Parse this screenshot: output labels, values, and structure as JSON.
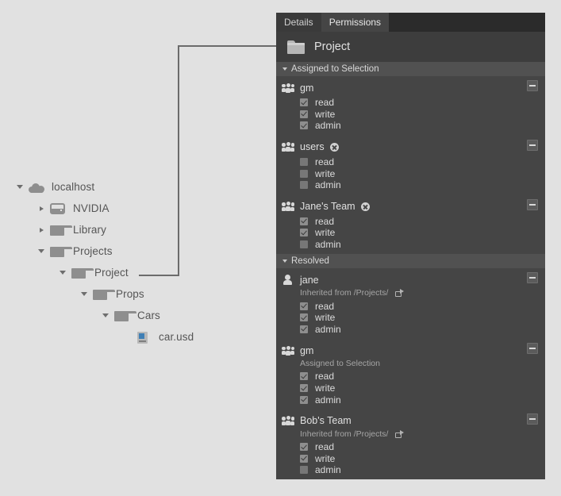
{
  "tabs": [
    {
      "label": "Details",
      "active": false
    },
    {
      "label": "Permissions",
      "active": true
    }
  ],
  "panel_header": {
    "title": "Project",
    "icon": "folder-icon"
  },
  "sections": [
    {
      "id": "assigned-to-selection",
      "title": "Assigned to Selection",
      "entries": [
        {
          "name": "gm",
          "icon": "group-icon",
          "removable": false,
          "subtitle": null,
          "link": false,
          "permissions": [
            {
              "label": "read",
              "checked": true
            },
            {
              "label": "write",
              "checked": true
            },
            {
              "label": "admin",
              "checked": true
            }
          ]
        },
        {
          "name": "users",
          "icon": "group-icon",
          "removable": true,
          "subtitle": null,
          "link": false,
          "permissions": [
            {
              "label": "read",
              "checked": false
            },
            {
              "label": "write",
              "checked": false
            },
            {
              "label": "admin",
              "checked": false
            }
          ]
        },
        {
          "name": "Jane's Team",
          "icon": "group-icon",
          "removable": true,
          "subtitle": null,
          "link": false,
          "permissions": [
            {
              "label": "read",
              "checked": true
            },
            {
              "label": "write",
              "checked": true
            },
            {
              "label": "admin",
              "checked": false
            }
          ]
        }
      ]
    },
    {
      "id": "resolved",
      "title": "Resolved",
      "entries": [
        {
          "name": "jane",
          "icon": "user-icon",
          "removable": false,
          "subtitle": "Inherited from /Projects/",
          "link": true,
          "permissions": [
            {
              "label": "read",
              "checked": true
            },
            {
              "label": "write",
              "checked": true
            },
            {
              "label": "admin",
              "checked": true
            }
          ]
        },
        {
          "name": "gm",
          "icon": "group-icon",
          "removable": false,
          "subtitle": "Assigned to Selection",
          "link": false,
          "permissions": [
            {
              "label": "read",
              "checked": true
            },
            {
              "label": "write",
              "checked": true
            },
            {
              "label": "admin",
              "checked": true
            }
          ]
        },
        {
          "name": "Bob's Team",
          "icon": "group-icon",
          "removable": false,
          "subtitle": "Inherited from /Projects/",
          "link": true,
          "permissions": [
            {
              "label": "read",
              "checked": true
            },
            {
              "label": "write",
              "checked": true
            },
            {
              "label": "admin",
              "checked": false
            }
          ]
        }
      ]
    }
  ],
  "tree": {
    "nodes": [
      {
        "label": "localhost",
        "icon": "cloud-icon",
        "depth": 0,
        "expander": "down",
        "selected": false
      },
      {
        "label": "NVIDIA",
        "icon": "drive-icon",
        "depth": 1,
        "expander": "right",
        "selected": false
      },
      {
        "label": "Library",
        "icon": "folder-icon",
        "depth": 1,
        "expander": "right",
        "selected": false
      },
      {
        "label": "Projects",
        "icon": "folder-icon",
        "depth": 1,
        "expander": "down",
        "selected": false
      },
      {
        "label": "Project",
        "icon": "folder-icon",
        "depth": 2,
        "expander": "down",
        "selected": true
      },
      {
        "label": "Props",
        "icon": "folder-icon",
        "depth": 3,
        "expander": "down",
        "selected": false
      },
      {
        "label": "Cars",
        "icon": "folder-icon",
        "depth": 4,
        "expander": "down",
        "selected": false
      },
      {
        "label": "car.usd",
        "icon": "usd-file-icon",
        "depth": 5,
        "expander": "none",
        "selected": false
      }
    ]
  },
  "colors": {
    "page_background": "#e1e1e1",
    "panel_background": "#454545",
    "panel_header": "#3d3d3d",
    "tabbar": "#2b2b2b",
    "section_bar": "#515151",
    "connector": "#6b6b6b",
    "text_primary": "#e0e0e0",
    "text_muted": "#a6a6a6",
    "tree_text": "#555555",
    "tree_icon": "#8e8e8e"
  }
}
